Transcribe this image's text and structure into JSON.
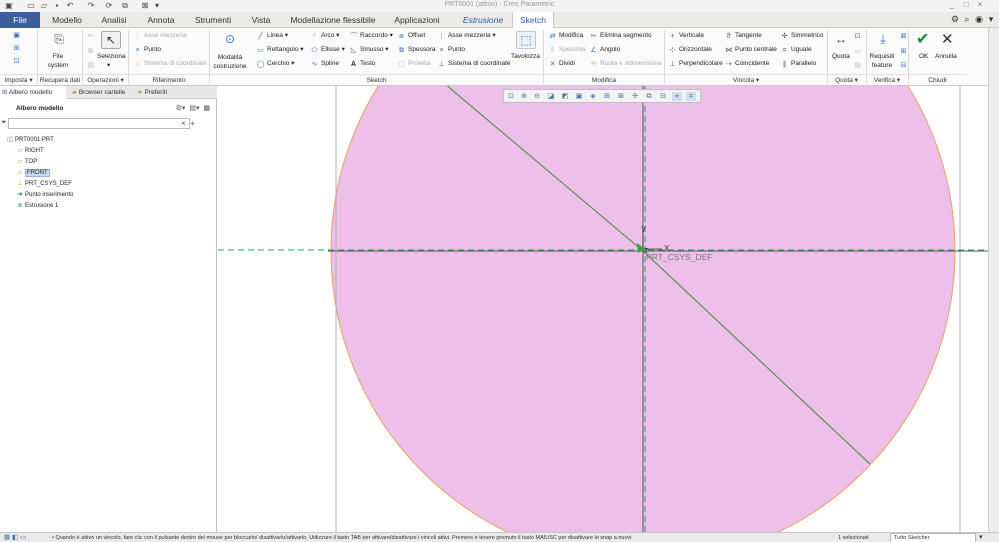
{
  "window": {
    "title": "PRT0001 (attivo) - Creo Parametric",
    "controls": [
      "_",
      "□",
      "×"
    ],
    "menu_right_icons": [
      "gear-icon",
      "search-icon",
      "help-icon",
      "expand-icon"
    ]
  },
  "menu": {
    "tabs": [
      {
        "label": "File",
        "name": "tab-file"
      },
      {
        "label": "Modello",
        "name": "tab-modello"
      },
      {
        "label": "Analisi",
        "name": "tab-analisi"
      },
      {
        "label": "Annota",
        "name": "tab-annota"
      },
      {
        "label": "Strumenti",
        "name": "tab-strumenti"
      },
      {
        "label": "Vista",
        "name": "tab-vista"
      },
      {
        "label": "Modellazione flessibile",
        "name": "tab-modellazione-flessibile"
      },
      {
        "label": "Applicazioni",
        "name": "tab-applicazioni"
      },
      {
        "label": "Estrusione",
        "name": "tab-estrusione"
      },
      {
        "label": "Sketch",
        "name": "tab-sketch"
      }
    ]
  },
  "ribbon": {
    "imposta": {
      "label": "Imposta ▾"
    },
    "recupera": {
      "button": "File\nsystem",
      "button_l1": "File",
      "button_l2": "system",
      "label": "Recupera dati"
    },
    "operazioni": {
      "seleziona": "Seleziona",
      "label": "Operazioni ▾"
    },
    "riferimento": {
      "asse_mezzeria": "Asse mezzeria",
      "punto": "Punto",
      "sistema_coordinate": "Sistema di coordinate",
      "label": "Riferimento"
    },
    "sketch": {
      "modalita_l1": "Modalità",
      "modalita_l2": "costruzione",
      "linea": "Linea ▾",
      "rettangolo": "Rettangolo ▾",
      "cerchio": "Cerchio ▾",
      "arco": "Arco ▾",
      "ellisse": "Ellisse ▾",
      "spline": "Spline",
      "raccordo": "Raccordo ▾",
      "smusso": "Smusso ▾",
      "testo": "Testo",
      "offset": "Offset",
      "spessora": "Spessora",
      "proietta": "Proietta",
      "asse_mezzeria": "Asse mezzeria ▾",
      "punto": "Punto",
      "sistema_coordinate": "Sistema di coordinate",
      "tavolozza": "Tavolozza",
      "label": "Sketch"
    },
    "modifica": {
      "modifica": "Modifica",
      "specchia": "Specchia",
      "dividi": "Dividi",
      "elimina_segmento": "Elimina segmento",
      "angolo": "Angolo",
      "ruota_ridimensiona": "Ruota e ridimensiona",
      "label": "Modifica"
    },
    "vincola": {
      "verticale": "Verticale",
      "orizzontale": "Orizzontale",
      "perpendicolare": "Perpendicolare",
      "tangente": "Tangente",
      "punto_centrale": "Punto centrale",
      "coincidente": "Coincidente",
      "simmetrico": "Simmetrico",
      "uguale": "Uguale",
      "parallelo": "Parallelo",
      "label": "Vincola ▾"
    },
    "quota": {
      "quota": "Quota",
      "label": "Quota ▾"
    },
    "verifica": {
      "requisiti_l1": "Requisiti",
      "requisiti_l2": "feature",
      "label": "Verifica ▾"
    },
    "chiudi": {
      "ok": "OK",
      "annulla": "Annulla",
      "label": "Chiudi"
    }
  },
  "left_panel": {
    "tabs": [
      "Albero modello",
      "Browser cartelle",
      "Preferiti"
    ],
    "header": "Albero modello",
    "filter_placeholder": "",
    "tree": [
      {
        "label": "PRT0001.PRT",
        "icon": "part-icon",
        "indent": 0,
        "selected": false
      },
      {
        "label": "RIGHT",
        "icon": "datum-plane-icon",
        "indent": 1,
        "selected": false
      },
      {
        "label": "TOP",
        "icon": "datum-plane-icon",
        "indent": 1,
        "selected": false
      },
      {
        "label": "FRONT",
        "icon": "datum-plane-icon",
        "indent": 1,
        "selected": true
      },
      {
        "label": "PRT_CSYS_DEF",
        "icon": "csys-icon",
        "indent": 1,
        "selected": false
      },
      {
        "label": "Punto inserimento",
        "icon": "insert-arrow-icon",
        "indent": 1,
        "selected": false
      },
      {
        "label": "Estrusione 1",
        "icon": "extrude-icon",
        "indent": 1,
        "selected": false
      }
    ]
  },
  "graphics": {
    "csys_label": "PRT_CSYS_DEF",
    "axis_y": "Y",
    "axis_x": "X",
    "axis_z": "Z",
    "colors": {
      "fill": "#eebfe9",
      "outline": "#e8a060",
      "line": "#3a8a3a",
      "datum": "#20a060"
    }
  },
  "status": {
    "message": "• Quando è attivo un vincolo, fare clic con il pulsante destro del mouse per bloccarlo/ disattivarlo/attivarlo. Utilizzare il tasto TAB per attivare/disattivare i vincoli attivi. Premere e tenere premuto il tasto MAIUSC per disattivare lo snap a nuovi",
    "selected": "1 selezionati",
    "filter": "Tutto Sketcher"
  }
}
